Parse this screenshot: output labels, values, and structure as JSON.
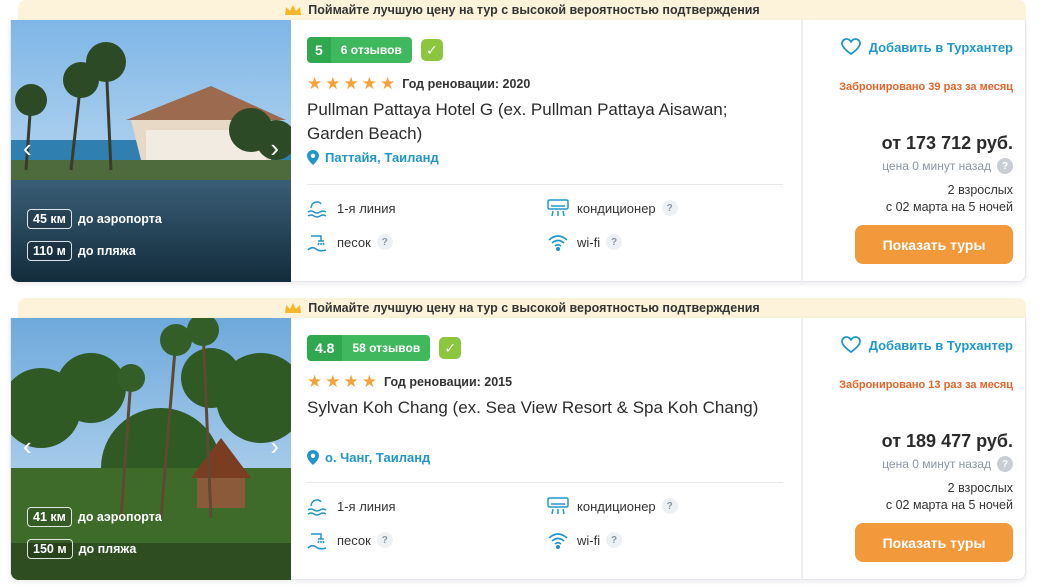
{
  "hotels": [
    {
      "banner": "Поймайте лучшую цену на тур с высокой вероятностью подтверждения",
      "score": "5",
      "reviews": "6 отзывов",
      "stars": 5,
      "renovation": "Год реновации: 2020",
      "name": "Pullman Pattaya Hotel G (ex. Pullman Pattaya Aisawan; Garden Beach)",
      "location": "Паттайя, Таиланд",
      "airport_value": "45 км",
      "airport_label": "до аэропорта",
      "beach_value": "110 м",
      "beach_label": "до пляжа",
      "amenities": {
        "line": "1-я линия",
        "ac": "кондиционер",
        "sand": "песок",
        "wifi": "wi-fi"
      },
      "favorite": "Добавить в Турхантер",
      "booked": "Забронировано 39 раз за месяц",
      "price": "от 173 712 руб.",
      "price_age": "цена 0 минут назад",
      "pax": "2 взрослых",
      "dates": "с 02 марта на 5 ночей",
      "cta": "Показать туры"
    },
    {
      "banner": "Поймайте лучшую цену на тур с высокой вероятностью подтверждения",
      "score": "4.8",
      "reviews": "58 отзывов",
      "stars": 4,
      "renovation": "Год реновации: 2015",
      "name": "Sylvan Koh Chang (ex. Sea View Resort & Spa Koh Chang)",
      "location": "о. Чанг, Таиланд",
      "airport_value": "41 км",
      "airport_label": "до аэропорта",
      "beach_value": "150 м",
      "beach_label": "до пляжа",
      "amenities": {
        "line": "1-я линия",
        "ac": "кондиционер",
        "sand": "песок",
        "wifi": "wi-fi"
      },
      "favorite": "Добавить в Турхантер",
      "booked": "Забронировано 13 раз за месяц",
      "price": "от 189 477 руб.",
      "price_age": "цена 0 минут назад",
      "pax": "2 взрослых",
      "dates": "с 02 марта на 5 ночей",
      "cta": "Показать туры"
    }
  ],
  "colors": {
    "accent_blue": "#2196c9",
    "score_green": "#2fa84f",
    "verified_green": "#8cc63f",
    "booked_orange": "#e5642a",
    "cta_orange": "#f29a3b",
    "star_gold": "#f3a33b",
    "banner_bg": "#fdf3da"
  },
  "icons": {
    "banner": "crown-icon",
    "verified": "checkmark-icon",
    "location": "map-pin-icon",
    "line": "waves-icon",
    "ac": "air-conditioner-icon",
    "sand": "beach-shower-icon",
    "wifi": "wifi-icon",
    "favorite": "heart-icon",
    "help": "question-icon",
    "prev": "chevron-left-icon",
    "next": "chevron-right-icon"
  }
}
